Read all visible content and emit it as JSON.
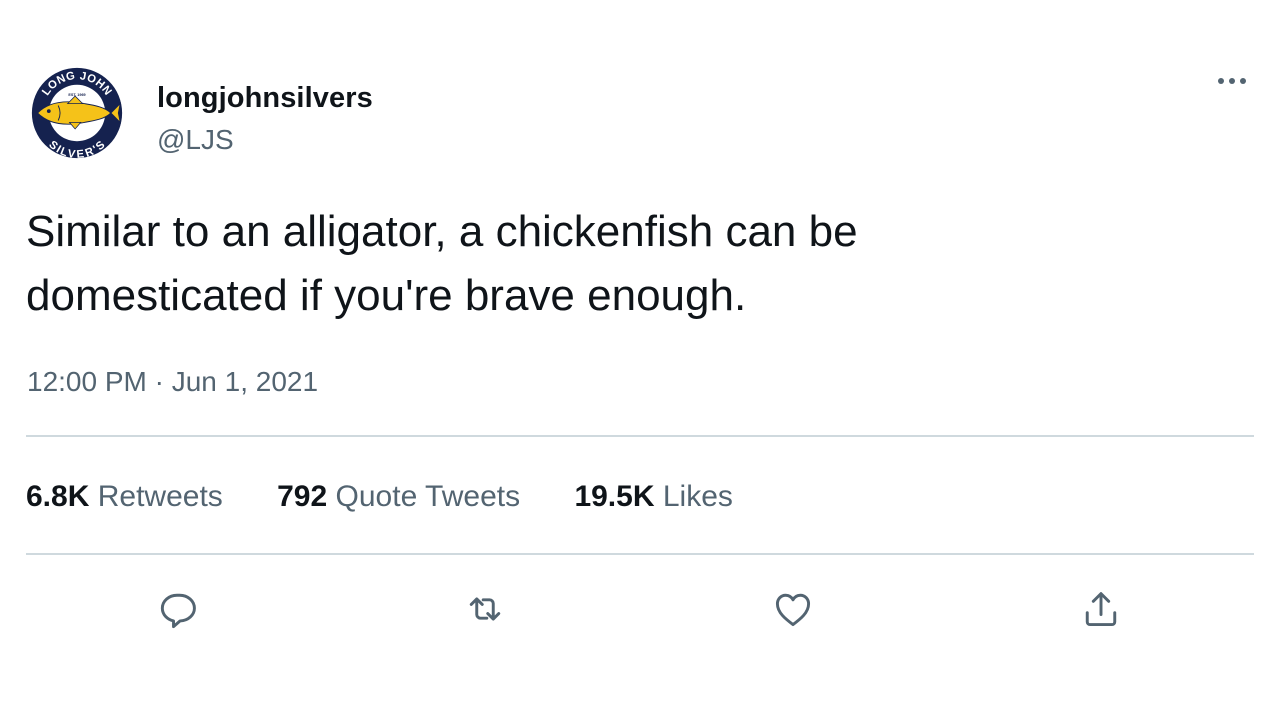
{
  "author": {
    "display_name": "longjohnsilvers",
    "handle": "@LJS",
    "avatar": {
      "icon": "long-john-silvers-logo",
      "text_top": "LONG JOHN",
      "text_bottom": "SILVER'S",
      "text_est": "EST. 1969",
      "navy": "#15224f",
      "gold": "#f5c219"
    }
  },
  "tweet": {
    "text_line1": "Similar to an alligator, a chickenfish can be",
    "text_line2": "domesticated if you're brave enough.",
    "timestamp": "12:00 PM · Jun 1, 2021"
  },
  "stats": {
    "retweets": {
      "count": "6.8K",
      "label": "Retweets"
    },
    "quotes": {
      "count": "792",
      "label": "Quote Tweets"
    },
    "likes": {
      "count": "19.5K",
      "label": "Likes"
    }
  },
  "actions": [
    {
      "icon": "reply-icon"
    },
    {
      "icon": "retweet-icon"
    },
    {
      "icon": "like-icon"
    },
    {
      "icon": "share-icon"
    }
  ],
  "colors": {
    "primary_text": "#0f1419",
    "secondary_text": "#536471",
    "divider": "#cfd9de"
  }
}
